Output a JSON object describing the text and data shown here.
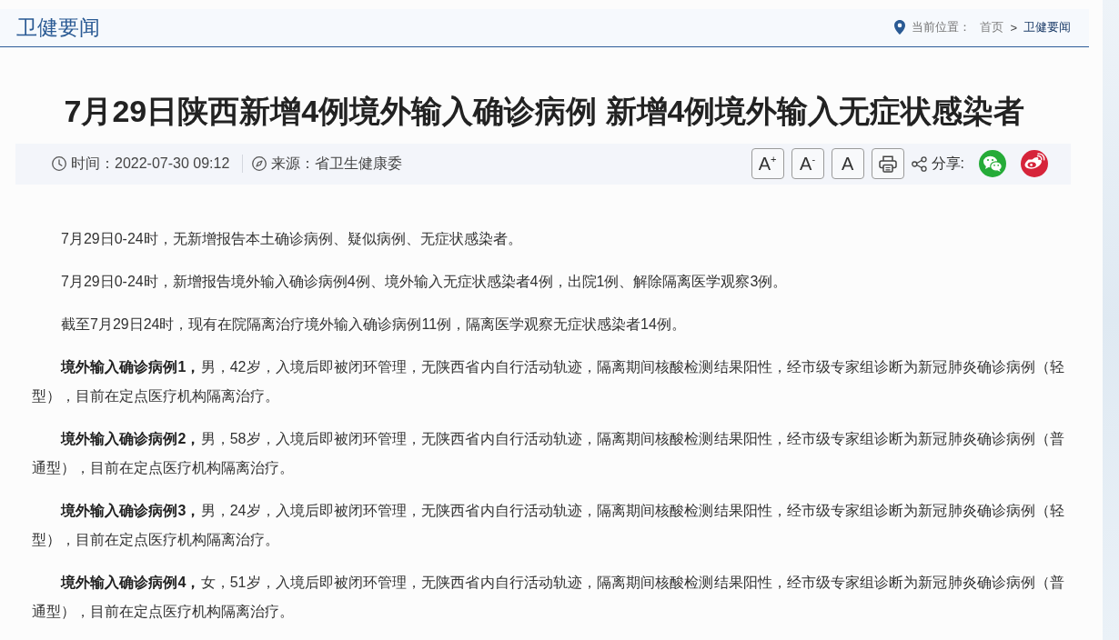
{
  "header": {
    "title": "卫健要闻",
    "breadcrumb": {
      "label": "当前位置：",
      "separator": ">",
      "items": [
        {
          "text": "首页",
          "current": false
        },
        {
          "text": "卫健要闻",
          "current": true
        }
      ]
    }
  },
  "article": {
    "title": "7月29日陕西新增4例境外输入确诊病例 新增4例境外输入无症状感染者",
    "meta": {
      "time": "时间：2022-07-30 09:12",
      "source": "来源：省卫生健康委"
    },
    "font_buttons": [
      "A$^{+}$",
      "A$^{-}$",
      "A"
    ],
    "share": {
      "label": "分享:",
      "services": [
        {
          "kind": "wechat",
          "color": "#25ab38"
        },
        {
          "kind": "weibo",
          "color": "#d6243a"
        }
      ]
    },
    "paragraphs": [
      "7月29日0-24时，无新增报告本土确诊病例、疑似病例、无症状感染者。",
      "7月29日0-24时，新增报告境外输入确诊病例4例、境外输入无症状感染者4例，出院1例、解除隔离医学观察3例。",
      "截至7月29日24时，现有在院隔离治疗境外输入确诊病例11例，隔离医学观察无症状感染者14例。",
      "**境外输入确诊病例1，**男，42岁，入境后即被闭环管理，无陕西省内自行活动轨迹，隔离期间核酸检测结果阳性，经市级专家组诊断为新冠肺炎确诊病例（轻型），目前在定点医疗机构隔离治疗。",
      "**境外输入确诊病例2，**男，58岁，入境后即被闭环管理，无陕西省内自行活动轨迹，隔离期间核酸检测结果阳性，经市级专家组诊断为新冠肺炎确诊病例（普通型），目前在定点医疗机构隔离治疗。",
      "**境外输入确诊病例3，**男，24岁，入境后即被闭环管理，无陕西省内自行活动轨迹，隔离期间核酸检测结果阳性，经市级专家组诊断为新冠肺炎确诊病例（轻型），目前在定点医疗机构隔离治疗。",
      "**境外输入确诊病例4，**女，51岁，入境后即被闭环管理，无陕西省内自行活动轨迹，隔离期间核酸检测结果阳性，经市级专家组诊断为新冠肺炎确诊病例（普通型），目前在定点医疗机构隔离治疗。"
    ]
  }
}
